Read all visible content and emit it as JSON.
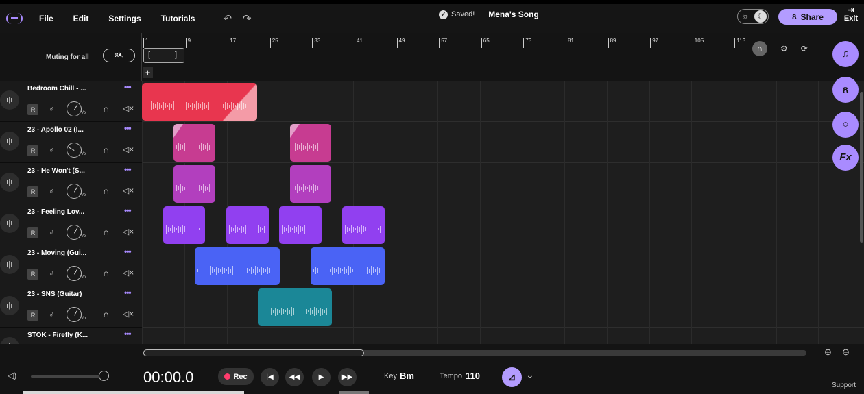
{
  "menu": [
    "File",
    "Edit",
    "Settings",
    "Tutorials"
  ],
  "status": {
    "saved": "Saved!",
    "song_name": "Mena's Song"
  },
  "header": {
    "share": "Share",
    "exit": "Exit"
  },
  "mute": {
    "label": "Muting for all"
  },
  "ruler": {
    "ticks": [
      "1",
      "9",
      "17",
      "25",
      "33",
      "41",
      "49",
      "57",
      "65",
      "73",
      "81",
      "89",
      "97",
      "105",
      "113"
    ]
  },
  "tracks": [
    {
      "name": "Bedroom Chill - ..."
    },
    {
      "name": "23 - Apollo 02 (I..."
    },
    {
      "name": "23 - He Won't (S..."
    },
    {
      "name": "23 - Feeling Lov..."
    },
    {
      "name": "23 - Moving (Gui..."
    },
    {
      "name": "23 - SNS (Guitar)"
    },
    {
      "name": "STOK - Firefly (K..."
    }
  ],
  "track_controls": {
    "rec": "R",
    "vol": "Vol"
  },
  "colors": {
    "accent": "#b39cff",
    "red": "#e8364f",
    "magenta": "#c73c91",
    "orchid": "#b23fbe",
    "violet": "#9140f0",
    "blue": "#4a63f5",
    "teal": "#1b8797"
  },
  "transport": {
    "time": "00:00.0",
    "rec": "Rec",
    "key_label": "Key",
    "key_value": "Bm",
    "tempo_label": "Tempo",
    "tempo_value": "110"
  },
  "footer": {
    "support": "Support"
  }
}
